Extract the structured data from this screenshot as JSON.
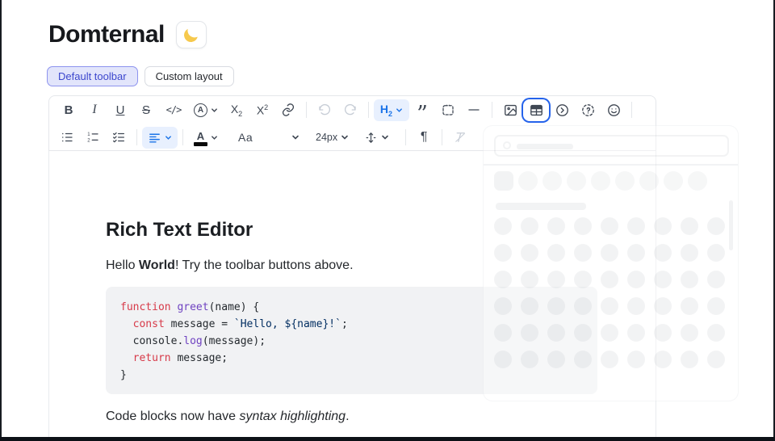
{
  "header": {
    "title": "Domternal",
    "theme_toggle_emoji": "🌙"
  },
  "tabs": {
    "default_toolbar": "Default toolbar",
    "custom_layout": "Custom layout"
  },
  "toolbar": {
    "row1": {
      "bold": "B",
      "italic": "I",
      "underline": "U",
      "strikethrough": "S",
      "inline_code": "</>",
      "text_style_letter": "A",
      "subscript_base": "X",
      "subscript_small": "2",
      "superscript_base": "X",
      "superscript_small": "2",
      "heading_base": "H",
      "heading_level": "2",
      "blockquote_glyph": "”"
    },
    "row2": {
      "font_family": "Aa",
      "font_size": "24px",
      "paragraph_mark": "¶",
      "text_color_letter": "A"
    },
    "icon_names": [
      "link-icon",
      "undo-icon",
      "redo-icon",
      "code-block-icon",
      "horizontal-rule-icon",
      "image-icon",
      "table-icon",
      "details-icon",
      "special-character-icon",
      "emoji-icon",
      "bullet-list-icon",
      "ordered-list-icon",
      "task-list-icon",
      "align-left-icon",
      "line-height-icon",
      "clear-format-icon"
    ],
    "states": {
      "active_buttons": [
        "heading",
        "align"
      ],
      "focused_button": "table",
      "disabled_buttons": [
        "undo",
        "redo",
        "clear-format"
      ]
    }
  },
  "editor": {
    "heading": "Rich Text Editor",
    "intro_segments": [
      {
        "text": "Hello "
      },
      {
        "text": "World",
        "bold": true
      },
      {
        "text": "! Try the toolbar buttons above."
      }
    ],
    "code_block": {
      "language": "javascript",
      "lines": [
        [
          {
            "t": "kw",
            "v": "function"
          },
          {
            "t": "pl",
            "v": " "
          },
          {
            "t": "fn",
            "v": "greet"
          },
          {
            "t": "pl",
            "v": "(name) {"
          }
        ],
        [
          {
            "t": "pl",
            "v": "  "
          },
          {
            "t": "kw",
            "v": "const"
          },
          {
            "t": "pl",
            "v": " message = "
          },
          {
            "t": "str",
            "v": "`Hello, ${name}!`"
          },
          {
            "t": "pl",
            "v": ";"
          }
        ],
        [
          {
            "t": "pl",
            "v": "  console."
          },
          {
            "t": "fn",
            "v": "log"
          },
          {
            "t": "pl",
            "v": "(message);"
          }
        ],
        [
          {
            "t": "pl",
            "v": "  "
          },
          {
            "t": "kw",
            "v": "return"
          },
          {
            "t": "pl",
            "v": " message;"
          }
        ],
        [
          {
            "t": "pl",
            "v": "}"
          }
        ]
      ]
    },
    "outro_segments": [
      {
        "text": "Code blocks now have "
      },
      {
        "text": "syntax highlighting",
        "italic": true
      },
      {
        "text": "."
      }
    ]
  },
  "colors": {
    "accent_blue": "#1a73e8",
    "active_bg": "#e8f0fe",
    "tab_active_bg": "#e2e5fb",
    "tab_active_border": "#8d93ee",
    "tab_active_text": "#3c47cd",
    "focus_ring": "#2563eb",
    "icon": "#3f4753",
    "icon_disabled": "#c7cdd6",
    "code_bg": "#f1f2f4",
    "code_text": "#24292e",
    "code_keyword": "#d73a49",
    "code_function": "#6f42c1",
    "code_string": "#032f62"
  }
}
